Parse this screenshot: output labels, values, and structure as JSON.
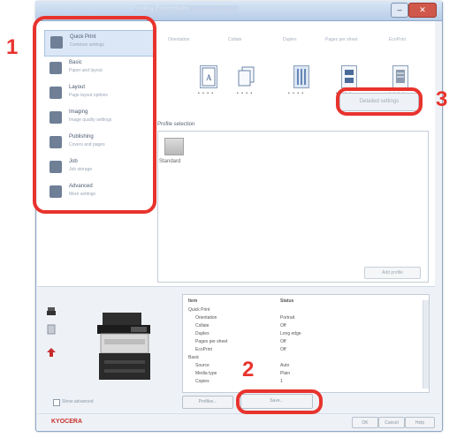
{
  "window": {
    "title": "Printing Preferences",
    "controls": {
      "minimize": "–",
      "close": "✕"
    }
  },
  "sidebar": {
    "items": [
      {
        "title": "Quick Print",
        "desc": "Common settings",
        "icon": "quick-print-icon"
      },
      {
        "title": "Basic",
        "desc": "Paper and layout",
        "icon": "basic-icon"
      },
      {
        "title": "Layout",
        "desc": "Page layout options",
        "icon": "layout-icon"
      },
      {
        "title": "Imaging",
        "desc": "Image quality settings",
        "icon": "imaging-icon"
      },
      {
        "title": "Publishing",
        "desc": "Covers and pages",
        "icon": "publishing-icon"
      },
      {
        "title": "Job",
        "desc": "Job storage",
        "icon": "job-icon"
      },
      {
        "title": "Advanced",
        "desc": "More settings",
        "icon": "advanced-icon"
      }
    ]
  },
  "quick_print": {
    "columns": [
      "Orientation",
      "Collate",
      "Duplex",
      "Pages per sheet",
      "EcoPrint"
    ],
    "dots": "• • • •",
    "detail_button": "Detailed settings"
  },
  "profiles": {
    "label": "Profile selection",
    "items": [
      {
        "label": "Standard",
        "icon": "profile-icon"
      }
    ],
    "add_button": "Add profile"
  },
  "summary": {
    "headers": [
      "Item",
      "Status"
    ],
    "rows": [
      {
        "item": "Quick Print",
        "status": ""
      },
      {
        "item": "Orientation",
        "status": "Portrait"
      },
      {
        "item": "Collate",
        "status": "Off"
      },
      {
        "item": "Duplex",
        "status": "Long edge"
      },
      {
        "item": "Pages per sheet",
        "status": "Off"
      },
      {
        "item": "EcoPrint",
        "status": "Off"
      },
      {
        "item": "Basic",
        "status": ""
      },
      {
        "item": "Source",
        "status": "Auto"
      },
      {
        "item": "Media type",
        "status": "Plain"
      },
      {
        "item": "Copies",
        "status": "1"
      }
    ]
  },
  "footer": {
    "checkbox_label": "Show advanced",
    "profile_button": "Profiles...",
    "save_button": "Save...",
    "brand": "KYOCERA",
    "ok": "OK",
    "cancel": "Cancel",
    "help": "Help"
  },
  "annotations": {
    "callout_1": "1",
    "callout_2": "2",
    "callout_3": "3",
    "color": "#e8332d"
  }
}
